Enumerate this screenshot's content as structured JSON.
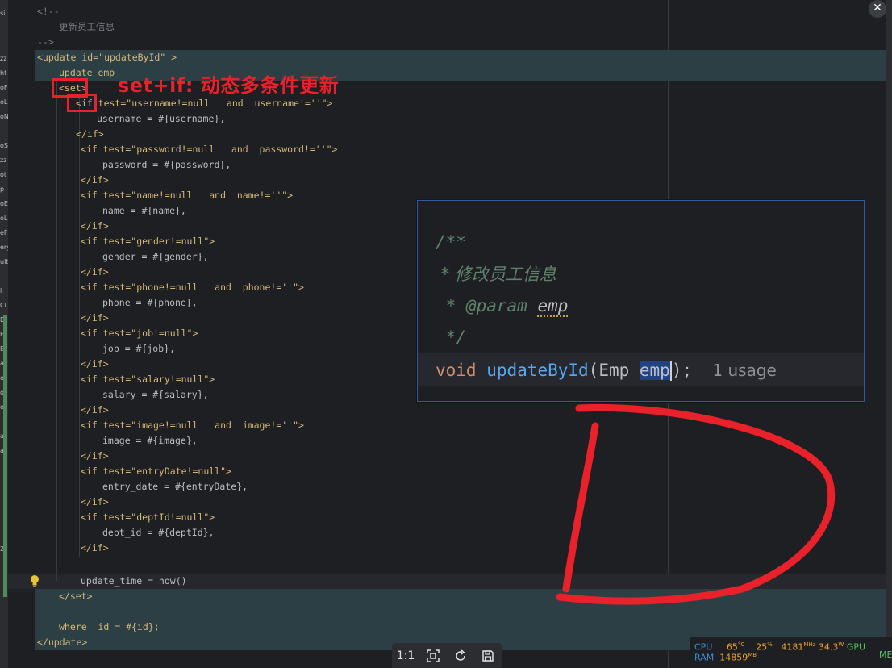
{
  "editor": {
    "code_lines": [
      "<!--",
      "更新员工信息",
      "-->",
      "<update id=\"updateById\" >",
      "update emp",
      "<set>",
      "<if test=\"username!=null   and  username!=''\">",
      "username = #{username},",
      "</if>",
      "<if test=\"password!=null   and  password!=''\">",
      "password = #{password},",
      "</if>",
      "<if test=\"name!=null   and  name!=''\">",
      "name = #{name},",
      "</if>",
      "<if test=\"gender!=null\">",
      "gender = #{gender},",
      "</if>",
      "<if test=\"phone!=null   and  phone!=''\">",
      "phone = #{phone},",
      "</if>",
      "<if test=\"job!=null\">",
      "job = #{job},",
      "</if>",
      "<if test=\"salary!=null\">",
      "salary = #{salary},",
      "</if>",
      "<if test=\"image!=null   and  image!=''\">",
      "image = #{image},",
      "</if>",
      "<if test=\"entryDate!=null\">",
      "entry_date = #{entryDate},",
      "</if>",
      "<if test=\"deptId!=null\">",
      "dept_id = #{deptId},",
      "</if>",
      "",
      "update_time = now()",
      "</set>",
      "",
      "where  id = #{id};",
      "</update>"
    ]
  },
  "annotation": {
    "text": "set+if: 动态多条件更新",
    "color": "#e8212b"
  },
  "popup": {
    "doc_open": "/**",
    "doc_line1": " * 修改员工信息",
    "doc_param_prefix": " * @param ",
    "doc_param_name": "emp",
    "doc_close": " */",
    "sig_return": "void",
    "sig_method": "updateById",
    "sig_open": "(Emp ",
    "sig_param_selected": "emp",
    "sig_close": ");",
    "usage_hint": "1 usage"
  },
  "left_strip": {
    "labels": [
      "si",
      "zz",
      "ht",
      "oF",
      "oL",
      "oN",
      "oS",
      "zz",
      "ot",
      "p",
      "oE",
      "oL",
      "eF",
      "ery",
      "ult",
      "l",
      "Cl",
      "D",
      "E",
      "E",
      "ax",
      "ot",
      "o",
      "o",
      "a",
      "al",
      "2"
    ]
  },
  "toolbar": {
    "ratio_label": "1:1",
    "icons": [
      "fit-screen-icon",
      "rotate-icon",
      "save-icon"
    ]
  },
  "monitor": {
    "cpu_label": "CPU",
    "cpu_temp": "65",
    "cpu_temp_unit": "°C",
    "cpu_load": "25",
    "cpu_load_unit": "%",
    "cpu_freq": "4181",
    "cpu_freq_unit": "MHz",
    "cpu_power": "34.3",
    "cpu_power_unit": "W",
    "gpu_label": "GPU",
    "ram_label": "RAM",
    "ram_used": "14859",
    "ram_unit": "MB",
    "mem_label": "MEM"
  },
  "colors": {
    "annotation_red": "#e8212b",
    "xml_tag": "#d5b778",
    "xml_string": "#6aab73",
    "doc_comment": "#5f826b",
    "keyword": "#cf8e6d",
    "method": "#56a8f5",
    "monitor_label": "#3b8fd9",
    "monitor_value": "#f0a030"
  }
}
